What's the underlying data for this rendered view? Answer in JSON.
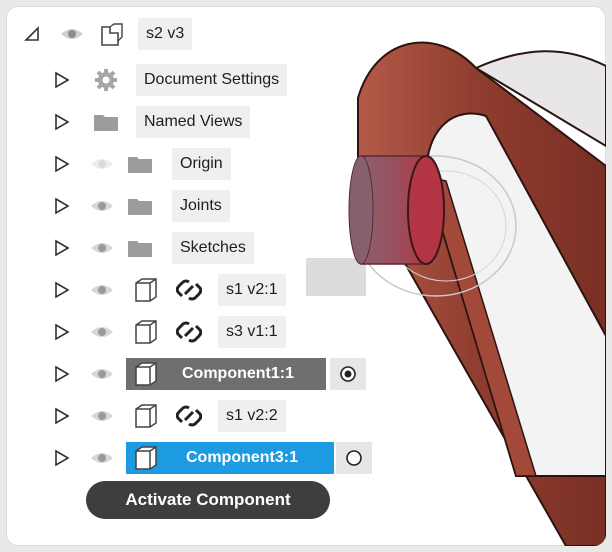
{
  "root": {
    "label": "s2 v3"
  },
  "items": [
    {
      "label": "Document Settings",
      "icon": "gear-icon"
    },
    {
      "label": "Named Views",
      "icon": "folder-icon"
    },
    {
      "label": "Origin",
      "icon": "folder-icon"
    },
    {
      "label": "Joints",
      "icon": "folder-icon"
    },
    {
      "label": "Sketches",
      "icon": "folder-icon"
    },
    {
      "label": "s1 v2:1",
      "icon": "component-link-icon"
    },
    {
      "label": "s3 v1:1",
      "icon": "component-link-icon"
    },
    {
      "label": "Component1:1",
      "icon": "component-icon",
      "active": true
    },
    {
      "label": "s1 v2:2",
      "icon": "component-link-icon"
    },
    {
      "label": "Component3:1",
      "icon": "component-icon",
      "selected": true
    }
  ],
  "tooltip": {
    "label": "Activate Component"
  },
  "colors": {
    "selection_blue": "#1c9be3",
    "active_gray": "#6f6f6f",
    "part_red": "#9a4536"
  }
}
